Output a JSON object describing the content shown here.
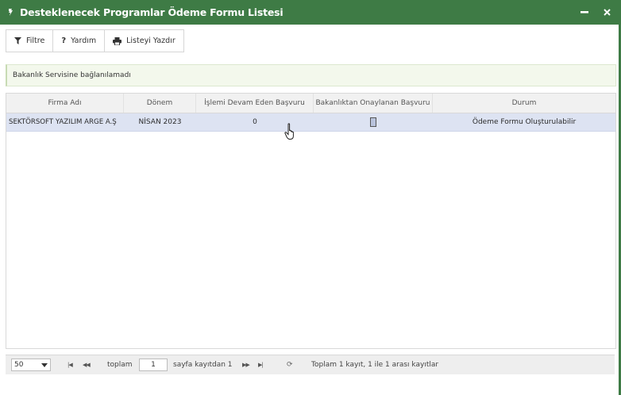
{
  "window": {
    "title": "Desteklenecek Programlar Ödeme Formu Listesi",
    "minimize_glyph": "—",
    "close_glyph": "✕"
  },
  "toolbar": {
    "filter_label": "Filtre",
    "help_label": "Yardım",
    "print_label": "Listeyi Yazdır"
  },
  "alert": {
    "message": "Bakanlık Servisine bağlanılamadı"
  },
  "grid": {
    "columns": [
      "Firma Adı",
      "Dönem",
      "İşlemi Devam Eden Başvuru",
      "Bakanlıktan Onaylanan Başvuru",
      "Durum"
    ],
    "rows": [
      {
        "firma": "SEKTÖRSOFT YAZILIM ARGE A.Ş",
        "donem": "NİSAN 2023",
        "islemde": "0",
        "onaylanan": "",
        "durum": "Ödeme Formu Oluşturulabilir"
      }
    ]
  },
  "pager": {
    "page_size": "50",
    "total_label": "toplam",
    "page_value": "1",
    "page_suffix": "sayfa kayıtdan 1",
    "summary": "Toplam 1 kayıt, 1 ile 1 arası kayıtlar"
  },
  "colors": {
    "titlebar": "#3e7b45",
    "selected_row": "#dde3f2",
    "alert_bg": "#f3f8ec"
  }
}
